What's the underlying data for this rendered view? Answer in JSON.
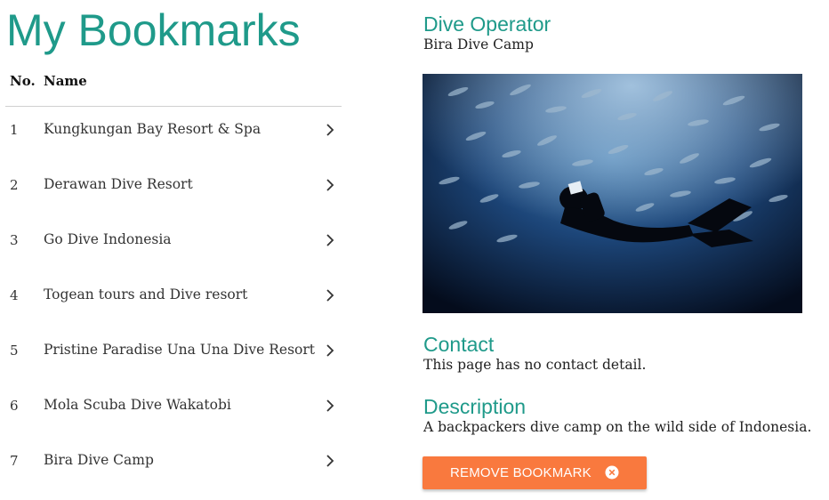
{
  "page": {
    "title": "My Bookmarks"
  },
  "table": {
    "headers": {
      "no": "No.",
      "name": "Name"
    },
    "rows": [
      {
        "no": "1",
        "name": "Kungkungan Bay Resort & Spa"
      },
      {
        "no": "2",
        "name": "Derawan Dive Resort"
      },
      {
        "no": "3",
        "name": "Go Dive Indonesia"
      },
      {
        "no": "4",
        "name": "Togean tours and Dive resort"
      },
      {
        "no": "5",
        "name": "Pristine Paradise Una Una Dive Resort"
      },
      {
        "no": "6",
        "name": "Mola Scuba Dive Wakatobi"
      },
      {
        "no": "7",
        "name": "Bira Dive Camp"
      }
    ]
  },
  "detail": {
    "operator_heading": "Dive Operator",
    "operator_name": "Bira Dive Camp",
    "contact_heading": "Contact",
    "contact_text": "This page has no contact detail.",
    "description_heading": "Description",
    "description_text": "A backpackers dive camp on the wild side of Indonesia.",
    "remove_label": "REMOVE BOOKMARK",
    "remove_icon": "close-circle-icon"
  },
  "colors": {
    "accent": "#1f9a8a",
    "button": "#f9793e"
  }
}
